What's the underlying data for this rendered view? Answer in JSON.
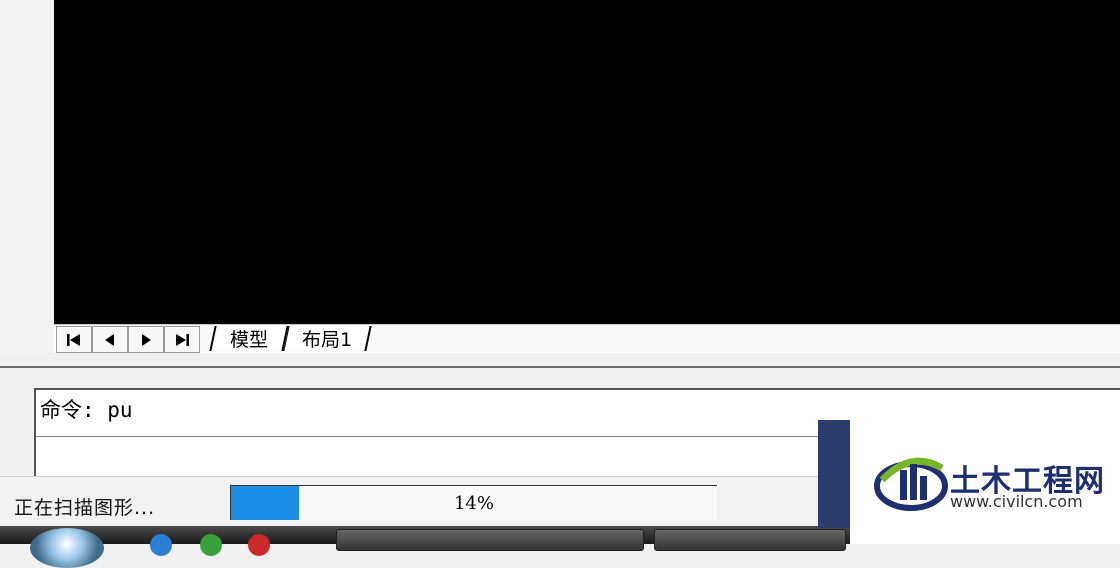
{
  "tabs": {
    "model": "模型",
    "layout1": "布局1"
  },
  "command": {
    "line": "命令: pu"
  },
  "status": {
    "text": "正在扫描图形...",
    "progress_fraction": 0.14,
    "progress_label": "14%"
  },
  "watermark": {
    "title": "土木工程网",
    "url": "www.civilcn.com"
  },
  "colors": {
    "canvas": "#000000",
    "progress": "#1e8fe6",
    "brand_navy": "#1d2f6e"
  }
}
